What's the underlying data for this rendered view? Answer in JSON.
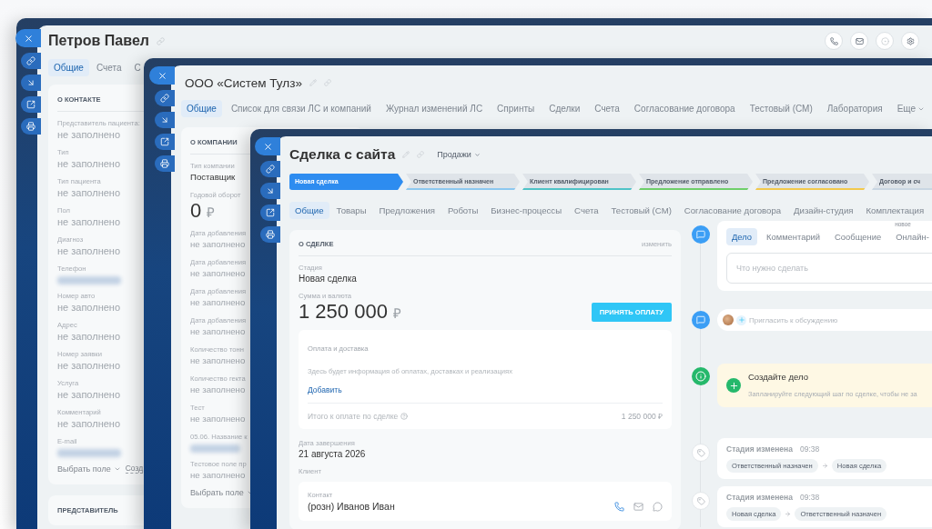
{
  "contact_window": {
    "title": "Петров Павел",
    "tabs": [
      {
        "label": "Общие",
        "selected": true
      },
      {
        "label": "Счета",
        "selected": false
      },
      {
        "label": "С",
        "selected": false
      }
    ],
    "card": {
      "title": "О КОНТАКТЕ",
      "fields": [
        {
          "label": "Представитель пациента:",
          "kind": "empty",
          "value": "не заполнено"
        },
        {
          "label": "Тип",
          "kind": "empty",
          "value": "не заполнено"
        },
        {
          "label": "Тип пациента",
          "kind": "empty",
          "value": "не заполнено"
        },
        {
          "label": "Пол",
          "kind": "empty",
          "value": "не заполнено"
        },
        {
          "label": "Диагноз",
          "kind": "empty",
          "value": "не заполнено"
        },
        {
          "label": "Телефон",
          "kind": "hidden"
        },
        {
          "label": "Номер авто",
          "kind": "empty",
          "value": "не заполнено"
        },
        {
          "label": "Адрес",
          "kind": "empty",
          "value": "не заполнено"
        },
        {
          "label": "Номер заявки",
          "kind": "empty",
          "value": "не заполнено"
        },
        {
          "label": "Услуга",
          "kind": "empty",
          "value": "не заполнено"
        },
        {
          "label": "Комментарий",
          "kind": "empty",
          "value": "не заполнено"
        },
        {
          "label": "E-mail",
          "kind": "hidden"
        }
      ],
      "select_field": "Выбрать поле",
      "create_field": "Созд"
    },
    "second_card_title": "ПРЕДСТАВИТЕЛЬ"
  },
  "company_window": {
    "title": "ООО «Систем Тулз»",
    "tabs": [
      {
        "label": "Общие",
        "selected": true
      },
      {
        "label": "Список для связи ЛС и компаний",
        "selected": false
      },
      {
        "label": "Журнал изменений ЛС",
        "selected": false
      },
      {
        "label": "Спринты",
        "selected": false
      },
      {
        "label": "Сделки",
        "selected": false
      },
      {
        "label": "Счета",
        "selected": false
      },
      {
        "label": "Согласование договора",
        "selected": false
      },
      {
        "label": "Тестовый (СМ)",
        "selected": false
      },
      {
        "label": "Лаборатория",
        "selected": false
      }
    ],
    "more": "Еще",
    "card": {
      "title": "О КОМПАНИИ",
      "fields": [
        {
          "label": "Тип компании",
          "kind": "text",
          "value": "Поставщик"
        },
        {
          "label": "Годовой оборот",
          "kind": "money",
          "value": "0",
          "currency": "₽"
        },
        {
          "label": "Дата добавления",
          "kind": "empty",
          "value": "не заполнено"
        },
        {
          "label": "Дата добавления",
          "kind": "empty",
          "value": "не заполнено"
        },
        {
          "label": "Дата добавления",
          "kind": "empty",
          "value": "не заполнено"
        },
        {
          "label": "Дата добавления",
          "kind": "empty",
          "value": "не заполнено"
        },
        {
          "label": "Количество тонн",
          "kind": "empty",
          "value": "не заполнено"
        },
        {
          "label": "Количество гекта",
          "kind": "empty",
          "value": "не заполнено"
        },
        {
          "label": "Тест",
          "kind": "empty",
          "value": "не заполнено"
        },
        {
          "label": "05.06. Название к",
          "kind": "hidden"
        },
        {
          "label": "Тестовое поле пр",
          "kind": "empty",
          "value": "не заполнено"
        }
      ],
      "select_field": "Выбрать поле"
    }
  },
  "deal_window": {
    "title": "Сделка с сайта",
    "pipeline": "Продажи",
    "stages": [
      {
        "label": "Новая сделка",
        "color": "#2d8cf0",
        "selected": true
      },
      {
        "label": "Ответственный назначен",
        "color": "#8cc8f0",
        "selected": false
      },
      {
        "label": "Клиент квалифицирован",
        "color": "#4fc3c7",
        "selected": false
      },
      {
        "label": "Предложение отправлено",
        "color": "#6fcf6a",
        "selected": false
      },
      {
        "label": "Предложение согласовано",
        "color": "#f2c94c",
        "selected": false
      },
      {
        "label": "Договор и сч",
        "color": "#c9d6e2",
        "selected": false
      }
    ],
    "tabs": [
      {
        "label": "Общие",
        "selected": true
      },
      {
        "label": "Товары",
        "selected": false
      },
      {
        "label": "Предложения",
        "selected": false
      },
      {
        "label": "Роботы",
        "selected": false
      },
      {
        "label": "Бизнес-процессы",
        "selected": false
      },
      {
        "label": "Счета",
        "selected": false
      },
      {
        "label": "Тестовый (СМ)",
        "selected": false
      },
      {
        "label": "Согласование договора",
        "selected": false
      },
      {
        "label": "Дизайн-студия",
        "selected": false
      },
      {
        "label": "Комплектация",
        "selected": false
      }
    ],
    "details": {
      "title": "О СДЕЛКЕ",
      "edit": "изменить",
      "stage_label": "Стадия",
      "stage_value": "Новая сделка",
      "amount_label": "Сумма и валюта",
      "amount": "1 250 000",
      "currency": "₽",
      "pay_button": "ПРИНЯТЬ ОПЛАТУ",
      "payment": {
        "title": "Оплата и доставка",
        "text": "Здесь будет информация об оплатах, доставках и реализациях",
        "add": "Добавить",
        "total_label": "Итого к оплате по сделке",
        "total": "1 250 000 ₽"
      },
      "close_date_label": "Дата завершения",
      "close_date": "21 августа 2026",
      "client_label": "Клиент",
      "contact": {
        "label": "Контакт",
        "name": "(розн) Иванов Иван"
      }
    },
    "timeline": {
      "composer": {
        "tabs": [
          {
            "label": "Дело",
            "selected": true
          },
          {
            "label": "Комментарий",
            "selected": false
          },
          {
            "label": "Сообщение",
            "selected": false
          },
          {
            "label": "Онлайн-",
            "selected": false,
            "badge": "новое"
          }
        ],
        "placeholder": "Что нужно сделать"
      },
      "invite": "Пригласить к обсуждению",
      "hint": {
        "title": "Создайте дело",
        "text": "Запланируйте следующий шаг по сделке, чтобы не за"
      },
      "history": [
        {
          "title": "Стадия изменена",
          "time": "09:38",
          "from": "Ответственный назначен",
          "to": "Новая сделка"
        },
        {
          "title": "Стадия изменена",
          "time": "09:38",
          "from": "Новая сделка",
          "to": "Ответственный назначен"
        }
      ]
    }
  }
}
